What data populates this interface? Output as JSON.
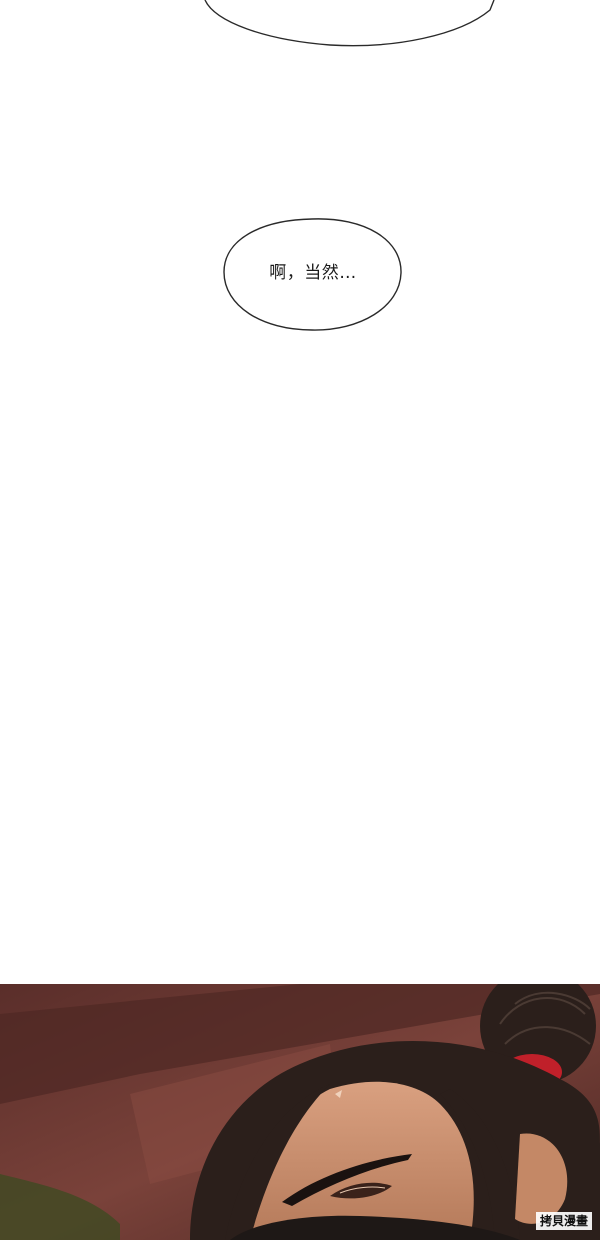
{
  "speech_bubble": {
    "text": "啊，当然…"
  },
  "watermark": {
    "text": "拷貝漫畫"
  },
  "colors": {
    "background": "#ffffff",
    "bubble_outline": "#2a2a2a",
    "panel_wall": "#6e3a34",
    "hair": "#2b1f1b",
    "skin": "#c98e6e",
    "hair_tie": "#c0202a"
  }
}
